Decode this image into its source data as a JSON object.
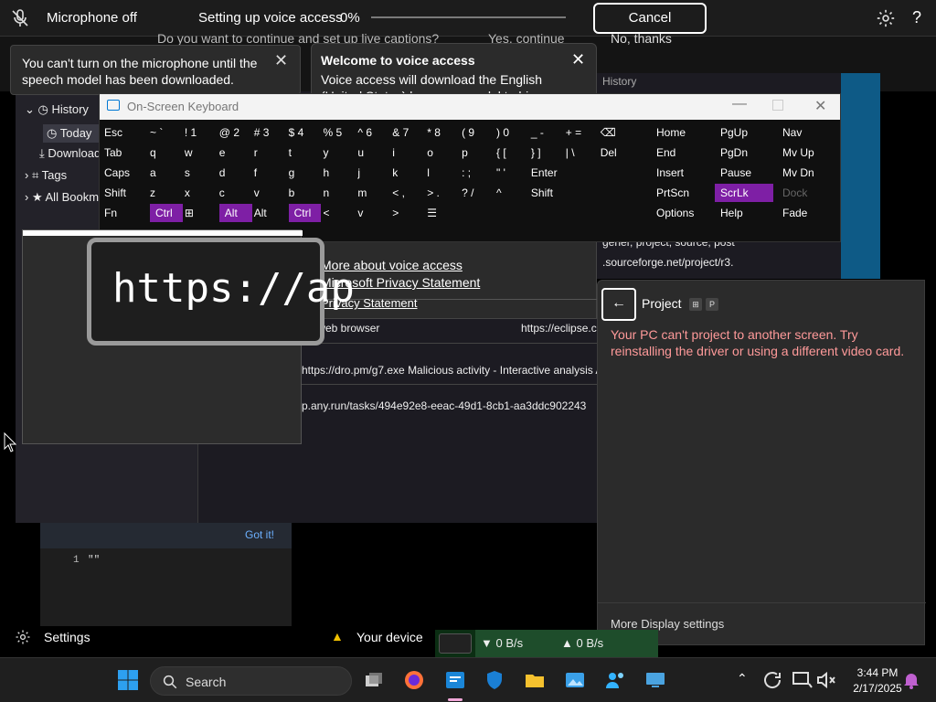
{
  "voice_bar": {
    "mic_status": "Microphone off",
    "setup_text": "Setting up voice access",
    "progress_text": "0%",
    "progress_value": 0,
    "cancel_label": "Cancel",
    "help_label": "?"
  },
  "background_prompt": {
    "question": "Do you want to continue and set up live captions?",
    "yes": "Yes, continue",
    "no": "No, thanks"
  },
  "toast": {
    "message": "You can't turn on the microphone until the speech model has been downloaded."
  },
  "welcome": {
    "title": "Welcome to voice access",
    "body": "Voice access will download the English (United States) language model to hi...",
    "link_more": "More about voice access",
    "link_privacy": "Microsoft Privacy Statement",
    "link_privacy2": "Privacy Statement"
  },
  "firefox": {
    "sidebar": [
      {
        "label": "History"
      },
      {
        "label": "Today"
      },
      {
        "label": "Downloads"
      },
      {
        "label": "Tags"
      },
      {
        "label": "All Bookmarks"
      }
    ],
    "history_label": "History",
    "rows": [
      {
        "title": "x web browser",
        "url": "https://eclipse.c"
      },
      {
        "title": "https://dro.pm/g7.exe Malicious activity - Interactive analysis A",
        "url": ""
      },
      {
        "title": "p.any.run/tasks/494e92e8-eeac-49d1-8cb1-aa3ddc902243",
        "url": ""
      }
    ],
    "right_snippets": [
      "gener, project, source, post",
      ".sourceforge.net/project/r3."
    ]
  },
  "osk": {
    "title": "On-Screen Keyboard",
    "rows": [
      [
        "Esc",
        "~ `",
        "! 1",
        "@ 2",
        "# 3",
        "$ 4",
        "% 5",
        "^ 6",
        "& 7",
        "* 8",
        "( 9",
        ") 0",
        "_ -",
        "+ =",
        "⌫"
      ],
      [
        "Tab",
        "q",
        "w",
        "e",
        "r",
        "t",
        "y",
        "u",
        "i",
        "o",
        "p",
        "{ [",
        "} ]",
        "| \\",
        "Del"
      ],
      [
        "Caps",
        "a",
        "s",
        "d",
        "f",
        "g",
        "h",
        "j",
        "k",
        "l",
        ": ;",
        "\" '",
        "Enter"
      ],
      [
        "Shift",
        "z",
        "x",
        "c",
        "v",
        "b",
        "n",
        "m",
        "< ,",
        "> .",
        "? /",
        "^",
        "Shift"
      ],
      [
        "Fn",
        "Ctrl",
        "⊞",
        "Alt",
        "Alt",
        "Ctrl",
        "<",
        "v",
        ">",
        "☰"
      ]
    ],
    "nav_keys": [
      [
        "Home",
        "PgUp",
        "Nav"
      ],
      [
        "End",
        "PgDn",
        "Mv Up"
      ],
      [
        "Insert",
        "Pause",
        "Mv Dn"
      ],
      [
        "PrtScn",
        "ScrLk",
        "Dock"
      ],
      [
        "Options",
        "Help",
        "Fade"
      ]
    ],
    "accent_color": "#7e1fa5"
  },
  "zoom": {
    "text": "https://ap"
  },
  "project": {
    "title": "Project",
    "shortcut_keys": [
      "⊞",
      "P"
    ],
    "error": "Your PC can't project to another screen. Try reinstalling the driver or using a different video card.",
    "more": "More Display settings",
    "error_color": "#ff9a9a"
  },
  "editor": {
    "got_it": "Got it!",
    "line_number": "1",
    "code": "\"\""
  },
  "settings_bar": {
    "label": "Settings",
    "device_text": "Your device"
  },
  "net": {
    "down": "▼ 0 B/s",
    "up": "▲ 0 B/s"
  },
  "taskbar": {
    "search_label": "Search",
    "time": "3:44 PM",
    "date": "2/17/2025"
  }
}
